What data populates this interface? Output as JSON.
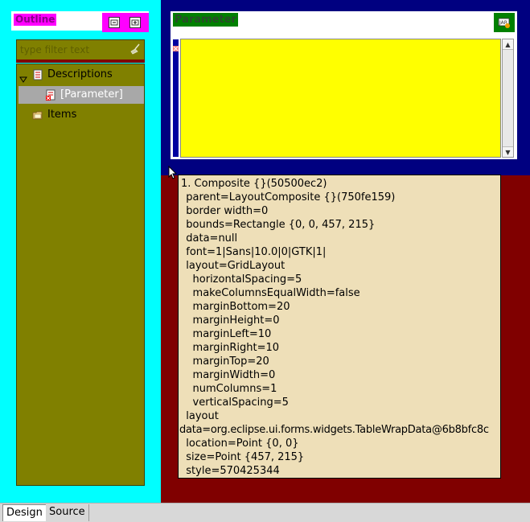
{
  "outline": {
    "title": "Outline",
    "filter_placeholder": "type filter text",
    "buttons": [
      "collapse-all-icon",
      "expand-all-icon"
    ],
    "tree": [
      {
        "label": "Descriptions",
        "expanded": true,
        "icon": "properties-icon"
      },
      {
        "label": "[Parameter]",
        "selected": true,
        "icon": "properties-error-icon"
      },
      {
        "label": "Items",
        "icon": "folder-icon"
      }
    ]
  },
  "parameter": {
    "title": "Parameter",
    "action_icon": "java-class-icon"
  },
  "tooltip": {
    "lines": [
      "1. Composite {}(50500ec2)",
      "  parent=LayoutComposite {}(750fe159)",
      "  border width=0",
      "  bounds=Rectangle {0, 0, 457, 215}",
      "  data=null",
      "  font=1|Sans|10.0|0|GTK|1|",
      "  layout=GridLayout",
      "    horizontalSpacing=5",
      "    makeColumnsEqualWidth=false",
      "    marginBottom=20",
      "    marginHeight=0",
      "    marginLeft=10",
      "    marginRight=10",
      "    marginTop=20",
      "    marginWidth=0",
      "    numColumns=1",
      "    verticalSpacing=5",
      "  layout",
      "data=org.eclipse.ui.forms.widgets.TableWrapData@6b8bfc8c",
      "  location=Point {0, 0}",
      "  size=Point {457, 215}",
      "  style=570425344"
    ]
  },
  "tabs": {
    "design": "Design",
    "source": "Source",
    "active": "Design"
  },
  "colors": {
    "outline_bg": "#00ffff",
    "header_highlight": "#ff00ff",
    "tree_bg": "#808000",
    "parameter_frame": "#000080",
    "parameter_body": "#ffff00",
    "outer_bg": "#800000",
    "tooltip_bg": "#eedfb8"
  }
}
